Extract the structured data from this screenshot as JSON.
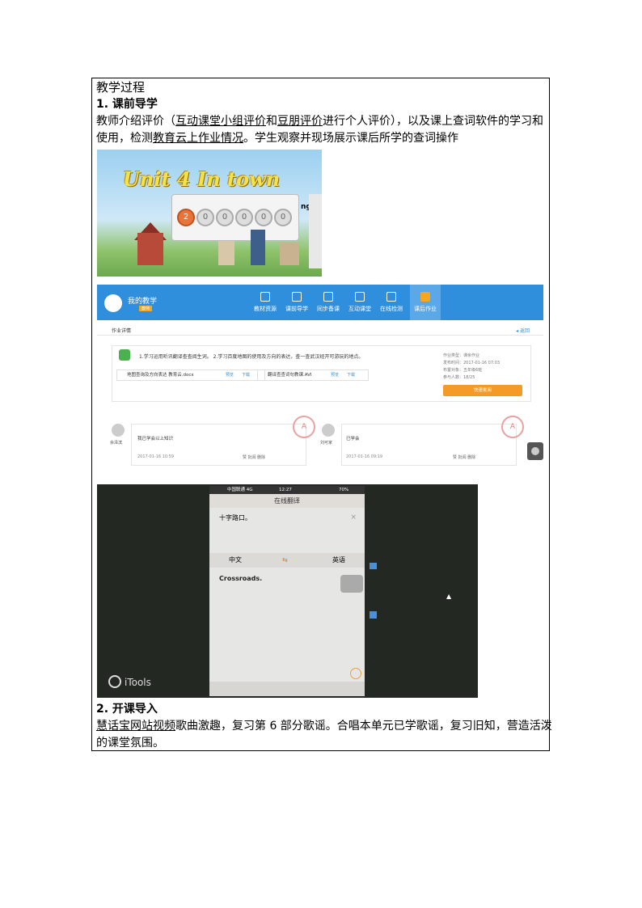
{
  "heading": "教学过程",
  "section1": {
    "title": "1.   课前导学",
    "line1_pre": "教师介绍评价（",
    "line1_u1": "互动课堂小组评价",
    "line1_mid": "和",
    "line1_u2": "豆朋评价",
    "line1_post": "进行个人评价），以及课上查词软件的学习和",
    "line2_pre": "使用，检测",
    "line2_u": "教育云上作业情况",
    "line2_post": "。学生观察并现场展示课后所学的查词操作"
  },
  "slide": {
    "title": "Unit 4   In town",
    "ng": "ng"
  },
  "platform": {
    "my_teaching": "我的教学",
    "tag": "教师",
    "tabs": [
      "教材资源",
      "课前导学",
      "同步备课",
      "互动课堂",
      "在线检测",
      "课后作业"
    ],
    "crumb": "作业详情",
    "back": "◂ 返回",
    "requirement": "1.学习运用听讯翻译查查阅生词。 2.学习百度地图的使用及方向的表达，查一查武汉经开可游玩的地点。",
    "files": [
      {
        "name": "地图查询及方向表达 教育云.docx",
        "preview": "预览",
        "download": "下载"
      },
      {
        "name": "翻译查查词句教课.AVI",
        "preview": "预览",
        "download": "下载"
      }
    ],
    "meta": [
      "作业类型：课余作业",
      "发布时间：2017-01-16 07:03",
      "布置对象：五年级6班",
      "参与人数：18/25"
    ],
    "quick_review": "快速批阅",
    "comments": [
      {
        "name": "余泽滨",
        "text": "我已学会以上知识",
        "date": "2017-01-16 10:59",
        "actions": "赞  批阅  删除"
      },
      {
        "name": "刘可家",
        "text": "已学会",
        "date": "2017-01-16 09:19",
        "actions": "赞  批阅  删除"
      }
    ]
  },
  "phone": {
    "status_left": "中国联通 4G",
    "status_time": "12:27",
    "status_right": "70%",
    "header": "在线翻译",
    "source_text": "十字路口。",
    "lang_from": "中文",
    "lang_to": "英语",
    "result": "Crossroads.",
    "brand": "iTools"
  },
  "section2": {
    "title": "2.   开课导入",
    "line1_u": "慧话宝网站视频",
    "line1_post": "歌曲激趣，复习第 6 部分歌谣。合唱本单元已学歌谣，复习旧知，营造活泼",
    "line2": "的课堂氛围。"
  }
}
